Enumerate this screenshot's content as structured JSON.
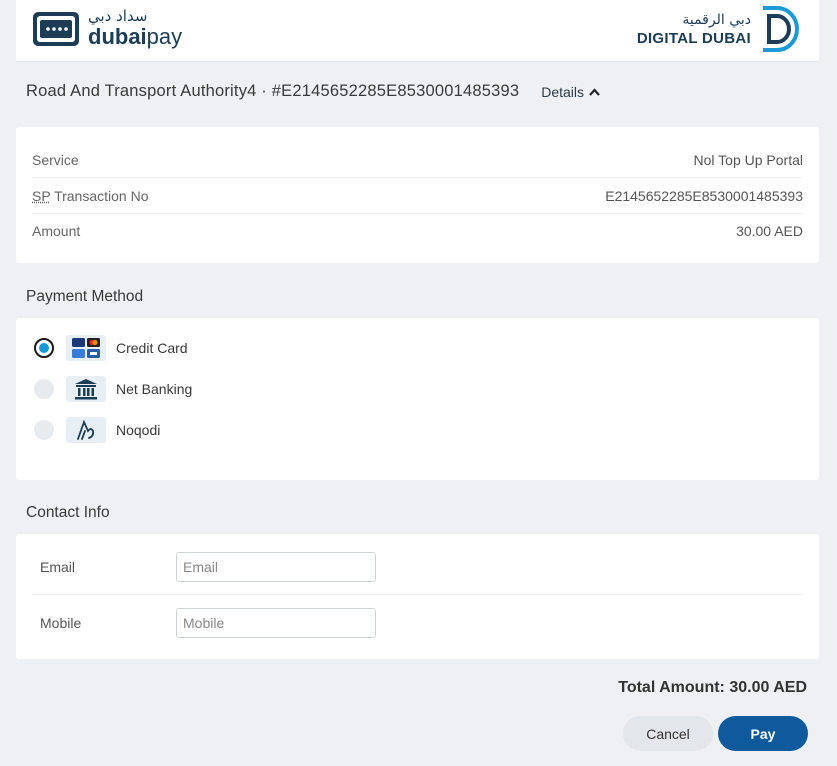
{
  "header": {
    "left_logo": {
      "arabic": "سداد دبي",
      "name_bold": "dubai",
      "name_light": "pay"
    },
    "right_logo": {
      "arabic": "دبي الرقمية",
      "name": "DIGITAL DUBAI"
    }
  },
  "transaction": {
    "title": "Road And Transport Authority4 · #E2145652285E8530001485393",
    "details_label": "Details"
  },
  "details": {
    "rows": [
      {
        "label": "Service",
        "value": "Nol Top Up Portal"
      },
      {
        "label_abbr": "SP",
        "label_rest": " Transaction No",
        "value": "E2145652285E8530001485393"
      },
      {
        "label": "Amount",
        "value": "30.00 AED"
      }
    ]
  },
  "payment": {
    "title": "Payment Method",
    "options": [
      {
        "label": "Credit Card",
        "icon": "credit-card-icon",
        "selected": true
      },
      {
        "label": "Net Banking",
        "icon": "bank-icon",
        "selected": false
      },
      {
        "label": "Noqodi",
        "icon": "noqodi-icon",
        "selected": false
      }
    ]
  },
  "contact": {
    "title": "Contact Info",
    "email": {
      "label": "Email",
      "placeholder": "Email",
      "value": ""
    },
    "mobile": {
      "label": "Mobile",
      "placeholder": "Mobile",
      "value": ""
    }
  },
  "footer": {
    "total": "Total Amount: 30.00 AED",
    "cancel_label": "Cancel",
    "pay_label": "Pay"
  },
  "colors": {
    "brand_navy": "#1c3d55",
    "accent_blue": "#1c9ad6",
    "pay_button": "#0e5a9c",
    "background": "#eef0f3"
  }
}
